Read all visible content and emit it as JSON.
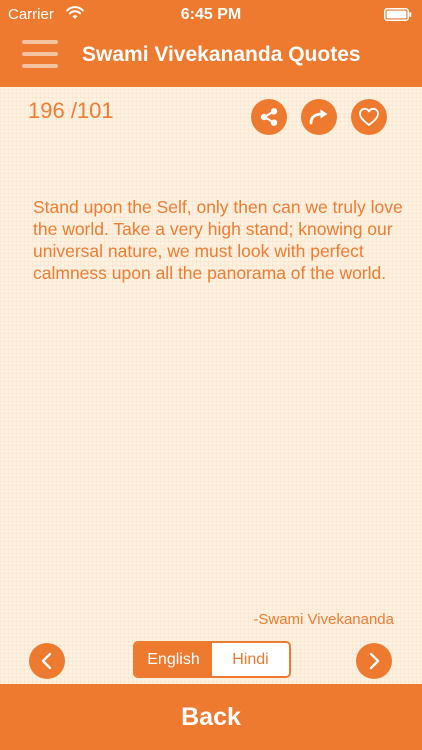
{
  "status_bar": {
    "carrier": "Carrier",
    "time": "6:45 PM",
    "wifi_icon": "wifi-icon",
    "battery_icon": "battery-icon"
  },
  "nav": {
    "title": "Swami Vivekananda Quotes",
    "menu_icon": "hamburger-menu-icon"
  },
  "counter": "196 /101",
  "actions": {
    "share_icon": "share-icon",
    "forward_icon": "forward-arrow-icon",
    "favorite_icon": "heart-icon"
  },
  "quote": {
    "text": "Stand upon the Self, only then can we truly love the world. Take a very high stand; knowing our universal nature, we must look with perfect calmness upon all the panorama of the world.",
    "author": "-Swami Vivekananda"
  },
  "language_toggle": {
    "options": [
      "English",
      "Hindi"
    ],
    "selected": "English"
  },
  "navigation": {
    "prev_icon": "chevron-left-icon",
    "next_icon": "chevron-right-icon"
  },
  "back_label": "Back",
  "colors": {
    "accent": "#ee7a2f",
    "background": "#fdf1e2",
    "text": "#ec7d33"
  }
}
